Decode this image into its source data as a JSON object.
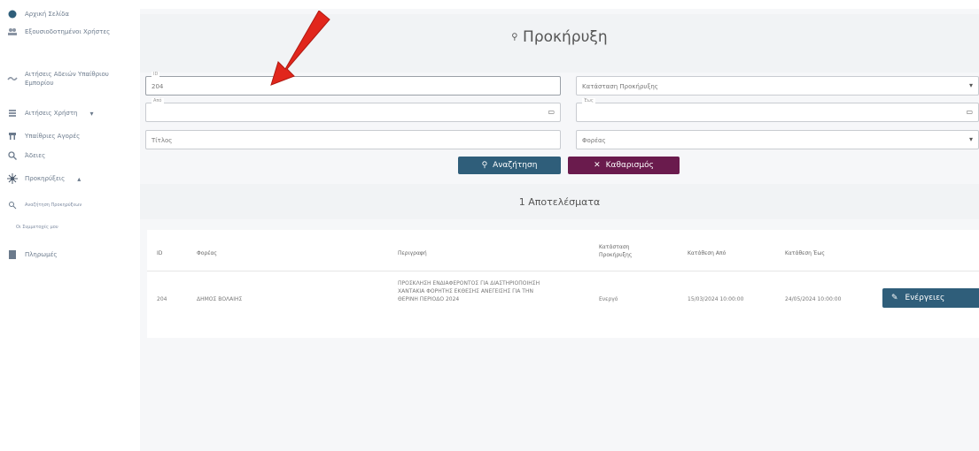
{
  "sidebar": {
    "items": [
      {
        "label": "Αρχική Σελίδα",
        "icon": "dashboard-icon"
      },
      {
        "label": "Εξουσιοδοτημένοι Χρήστες",
        "icon": "users-icon"
      },
      {
        "label": "Αιτήσεις Αδειών Υπαίθριου Εμπορίου",
        "icon": "wave-icon"
      },
      {
        "label": "Αιτήσεις Χρήστη",
        "icon": "list-icon"
      },
      {
        "label": "Υπαίθριες Αγορές",
        "icon": "market-icon"
      },
      {
        "label": "Άδειες",
        "icon": "search-icon"
      },
      {
        "label": "Προκηρύξεις",
        "icon": "settings-icon"
      },
      {
        "label": "Αναζήτηση Προκηρύξεων",
        "icon": "search-icon"
      },
      {
        "label": "Οι Συμμετοχές μου",
        "icon": ""
      },
      {
        "label": "Πληρωμές",
        "icon": "payment-icon"
      }
    ]
  },
  "main": {
    "title": "Προκήρυξη",
    "form": {
      "id_label": "ID",
      "id_value": "204",
      "category_placeholder": "Κατάσταση Προκήρυξης",
      "from_label": "Από",
      "to_label": "Έως",
      "title_placeholder": "Τίτλος",
      "agency_placeholder": "Φορέας"
    },
    "search_label": "Αναζήτηση",
    "clear_label": "Καθαρισμός",
    "results_title": "1 Αποτελέσματα",
    "table": {
      "headers": [
        "ID",
        "Φορέας",
        "Περιγραφή",
        "Κατάσταση Προκήρυξης",
        "Κατάθεση Από",
        "Κατάθεση Έως"
      ],
      "rows": [
        {
          "id": "204",
          "agency": "ΔΗΜΟΣ ΒΟΛΑΙΗΣ",
          "description": "ΠΡΟΣΚΛΗΣΗ ΕΝΔΙΑΦΕΡΟΝΤΟΣ ΓΙΑ ΔΙΑΣΤΗΡΙΟΠΟΙΗΣΗ ΧΑΝΤΑΚΙΑ ΦΟΡΗΤΗΣ ΕΚΘΕΣΗΣ ΑΝΕΓΕΙΣΗΣ ΓΙΑ ΤΗΝ ΘΕΡΙΝΗ ΠΕΡΙΟΔΟ 2024",
          "status": "Ενεργό",
          "from": "15/03/2024 10:00:00",
          "to": "24/05/2024 10:00:00",
          "action": "Ενέργειες"
        }
      ]
    }
  },
  "colors": {
    "primary": "#2f5e7a",
    "danger": "#6a1b4d",
    "arrow": "#e1261c"
  }
}
